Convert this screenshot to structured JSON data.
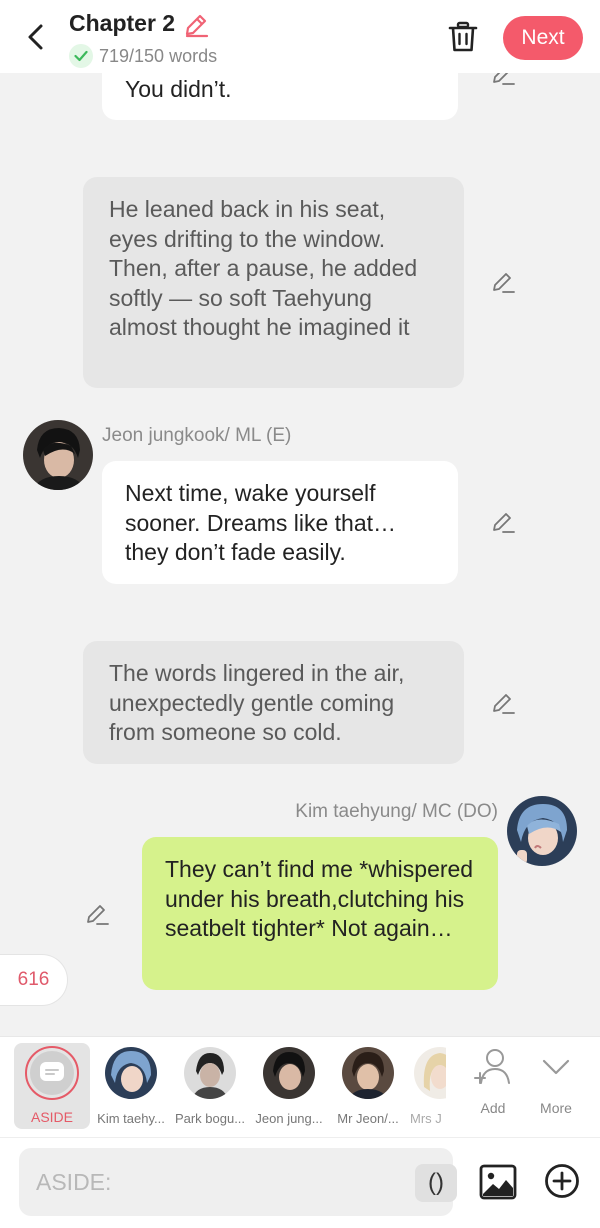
{
  "header": {
    "back_icon": "chevron-left-icon",
    "title": "Chapter 2",
    "word_count": "719/150 words",
    "next_label": "Next"
  },
  "messages": [
    {
      "type": "speech",
      "text": "You didn’t."
    },
    {
      "type": "narration",
      "text": "He leaned back in his seat, eyes drifting to the window. Then, after a pause, he added softly — so soft Taehyung almost thought he imagined it"
    },
    {
      "type": "speech",
      "speaker": "Jeon jungkook/ ML (E)",
      "text": "Next time, wake yourself sooner. Dreams like that… they don’t fade easily."
    },
    {
      "type": "narration",
      "text": "The words lingered in the air, unexpectedly gentle coming from someone so cold."
    },
    {
      "type": "speech",
      "speaker": "Kim taehyung/ MC (DO)",
      "text": "They can’t find me *whispered under his breath,clutching his seatbelt tighter* Not again…"
    }
  ],
  "counter": "616",
  "character_bar": {
    "aside_label": "ASIDE",
    "characters": [
      {
        "name": "Kim taehy..."
      },
      {
        "name": "Park bogu..."
      },
      {
        "name": "Jeon jung..."
      },
      {
        "name": "Mr Jeon/..."
      },
      {
        "name": "Mrs J"
      }
    ],
    "add_label": "Add",
    "more_label": "More"
  },
  "input": {
    "placeholder": "ASIDE:",
    "paren_label": "()"
  },
  "colors": {
    "accent": "#f45a6b",
    "aside_red": "#e55a67",
    "mc_bubble": "#d6f28c",
    "narration_bubble": "#e6e6e6",
    "background": "#f2f2f2"
  }
}
